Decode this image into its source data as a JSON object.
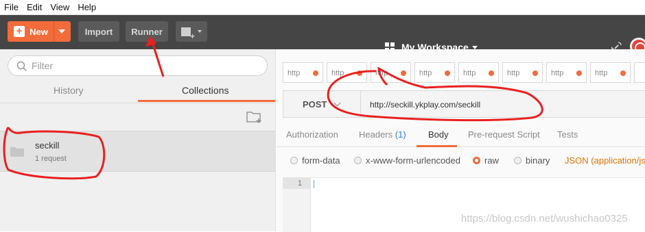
{
  "menu": [
    "File",
    "Edit",
    "View",
    "Help"
  ],
  "toolbar": {
    "new_label": "New",
    "import_label": "Import",
    "runner_label": "Runner",
    "workspace_label": "My Workspace"
  },
  "sidebar": {
    "filter_placeholder": "Filter",
    "tabs": {
      "history": "History",
      "collections": "Collections"
    },
    "collections": [
      {
        "name": "seckill",
        "subtitle": "1 request"
      }
    ]
  },
  "request_tabs": [
    "http",
    "http",
    "http",
    "http",
    "http",
    "http",
    "http",
    "http"
  ],
  "request": {
    "method": "POST",
    "url": "http://seckill.ykplay.com/seckill"
  },
  "request_subtabs": {
    "authorization": "Authorization",
    "headers": "Headers",
    "headers_count": "(1)",
    "body": "Body",
    "prerequest": "Pre-request Script",
    "tests": "Tests"
  },
  "body_modes": {
    "form_data": "form-data",
    "urlencoded": "x-www-form-urlencoded",
    "raw": "raw",
    "binary": "binary",
    "selected": "raw",
    "json_type": "JSON (application/json)"
  },
  "editor": {
    "line_number": "1"
  },
  "watermark": "https://blog.csdn.net/wushichao0325",
  "colors": {
    "accent": "#f26b3a",
    "toolbar": "#454545",
    "annotation": "#e8201f"
  }
}
